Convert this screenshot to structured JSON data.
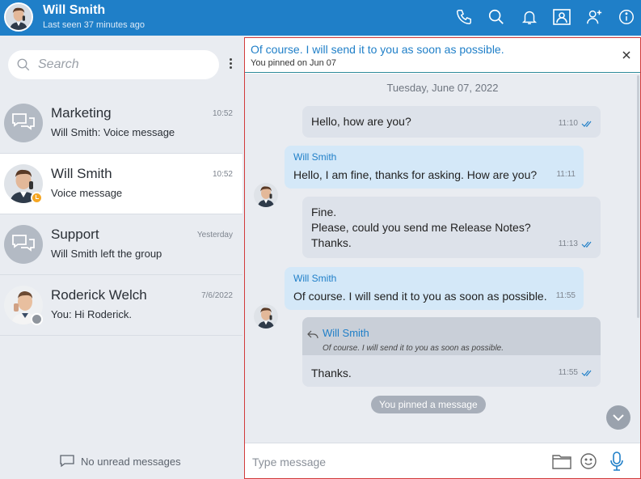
{
  "header": {
    "name": "Will Smith",
    "status": "Last seen 37 minutes ago",
    "accent": "#1f7fc8",
    "icons": [
      "phone-icon",
      "search-icon",
      "bell-icon",
      "contact-card-icon",
      "add-user-icon",
      "info-icon"
    ]
  },
  "search": {
    "placeholder": "Search"
  },
  "chats": [
    {
      "name": "Marketing",
      "preview": "Will Smith: Voice message",
      "time": "10:52",
      "avatar": "group"
    },
    {
      "name": "Will Smith",
      "preview": "Voice message",
      "time": "10:52",
      "avatar": "person",
      "status": "away"
    },
    {
      "name": "Support",
      "preview": "Will Smith left the group",
      "time": "Yesterday",
      "avatar": "group"
    },
    {
      "name": "Roderick Welch",
      "preview": "You: Hi Roderick.",
      "time": "7/6/2022",
      "avatar": "person",
      "status": "offline"
    }
  ],
  "no_unread": "No unread messages",
  "pinned": {
    "text": "Of course. I will send it to you as soon as possible.",
    "sub": "You pinned on Jun 07"
  },
  "date_separator": "Tuesday, June 07, 2022",
  "messages": [
    {
      "dir": "out",
      "text": "Hello, how are you?",
      "time": "11:10",
      "read": true
    },
    {
      "dir": "in",
      "sender": "Will Smith",
      "text": "Hello, I am fine, thanks for asking. How are you?",
      "time": "11:11"
    },
    {
      "dir": "out",
      "lines": [
        "Fine.",
        "Please, could you send me Release Notes?",
        "Thanks."
      ],
      "time": "11:13",
      "read": true
    },
    {
      "dir": "in",
      "sender": "Will Smith",
      "text": "Of course. I will send it to you as soon as possible.",
      "time": "11:55"
    },
    {
      "dir": "out",
      "quote_name": "Will Smith",
      "quote_text": "Of course. I will send it to you as soon as possible.",
      "text": "Thanks.",
      "time": "11:55",
      "read": true
    }
  ],
  "pin_notice": "You pinned a message",
  "composer": {
    "placeholder": "Type message"
  }
}
